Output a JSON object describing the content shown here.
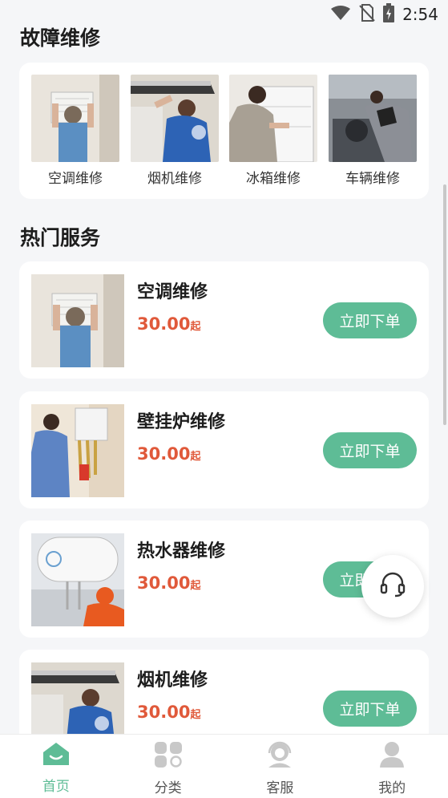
{
  "status_bar": {
    "time": "2:54",
    "icons": [
      "wifi-icon",
      "no-sim-icon",
      "battery-charging-icon"
    ]
  },
  "fault_section": {
    "title": "故障维修",
    "items": [
      {
        "label": "空调维修",
        "image": "ac-repair-photo"
      },
      {
        "label": "烟机维修",
        "image": "range-hood-repair-photo"
      },
      {
        "label": "冰箱维修",
        "image": "fridge-repair-photo"
      },
      {
        "label": "车辆维修",
        "image": "vehicle-repair-photo"
      }
    ]
  },
  "hot_section": {
    "title": "热门服务",
    "services": [
      {
        "name": "空调维修",
        "price": "30.00",
        "price_suffix": "起",
        "button": "立即下单",
        "image": "ac-repair-photo"
      },
      {
        "name": "壁挂炉维修",
        "price": "30.00",
        "price_suffix": "起",
        "button": "立即下单",
        "image": "wall-boiler-repair-photo"
      },
      {
        "name": "热水器维修",
        "price": "30.00",
        "price_suffix": "起",
        "button": "立即下单",
        "image": "water-heater-repair-photo"
      },
      {
        "name": "烟机维修",
        "price": "30.00",
        "price_suffix": "起",
        "button": "立即下单",
        "image": "range-hood-repair-photo"
      }
    ]
  },
  "floating_button": {
    "icon": "headset-icon"
  },
  "tabbar": {
    "tabs": [
      {
        "label": "首页",
        "icon": "home-icon",
        "active": true
      },
      {
        "label": "分类",
        "icon": "category-icon",
        "active": false
      },
      {
        "label": "客服",
        "icon": "customer-service-icon",
        "active": false
      },
      {
        "label": "我的",
        "icon": "profile-icon",
        "active": false
      }
    ]
  },
  "colors": {
    "accent": "#5ebc96",
    "price": "#e0593a",
    "background": "#f5f6f8",
    "card": "#ffffff"
  }
}
